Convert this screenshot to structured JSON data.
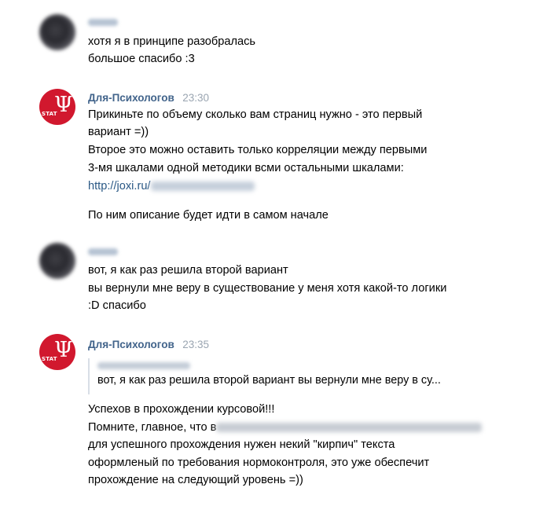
{
  "messages": [
    {
      "lines": [
        "хотя я в принципе разобралась",
        "большое спасибо :3"
      ]
    },
    {
      "author": "Для-Психологов",
      "time": "23:30",
      "lines": [
        "Прикиньте по объему сколько вам страниц нужно - это первый",
        "вариант =))",
        "Второе это можно оставить только корреляции между первыми",
        "3-мя шкалами одной методики всми остальными шкалами:"
      ],
      "link": "http://joxi.ru/",
      "after_link": "По ним описание будет идти в самом начале"
    },
    {
      "lines": [
        "вот, я как раз решила второй вариант",
        "вы вернули мне веру в существование у меня хотя какой-то логики",
        ":D спасибо"
      ]
    },
    {
      "author": "Для-Психологов",
      "time": "23:35",
      "quote": "вот, я как раз решила второй вариант вы вернули мне веру в су...",
      "lines": [
        "Успехов в прохождении курсовой!!!",
        "Помните, главное, что в",
        "для успешного прохождения нужен некий \"кирпич\" текста",
        "оформленый по требования нормоконтроля, это уже обеспечит",
        "прохождение на следующий уровень =))"
      ]
    }
  ],
  "group_avatar": {
    "symbol": "Ψ",
    "text": "STAT"
  }
}
